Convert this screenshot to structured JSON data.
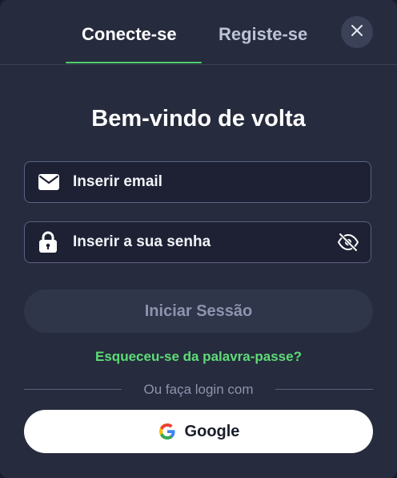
{
  "tabs": {
    "login_label": "Conecte-se",
    "register_label": "Registe-se",
    "active": "login"
  },
  "close_icon": "close-icon",
  "title": "Bem-vindo de volta",
  "email": {
    "icon": "envelope-icon",
    "placeholder": "Inserir email",
    "value": ""
  },
  "password": {
    "icon": "lock-icon",
    "placeholder": "Inserir a sua senha",
    "value": "",
    "toggle_icon": "eye-off-icon"
  },
  "submit_label": "Iniciar Sessão",
  "forgot_label": "Esqueceu-se da palavra-passe?",
  "divider_text": "Ou faça login com",
  "google": {
    "icon": "google-icon",
    "label": "Google"
  },
  "colors": {
    "accent": "#4fd06b",
    "link": "#5ddc78",
    "modal_bg": "#262b3d",
    "input_bg": "#1d2133",
    "input_border": "#5b6282"
  }
}
